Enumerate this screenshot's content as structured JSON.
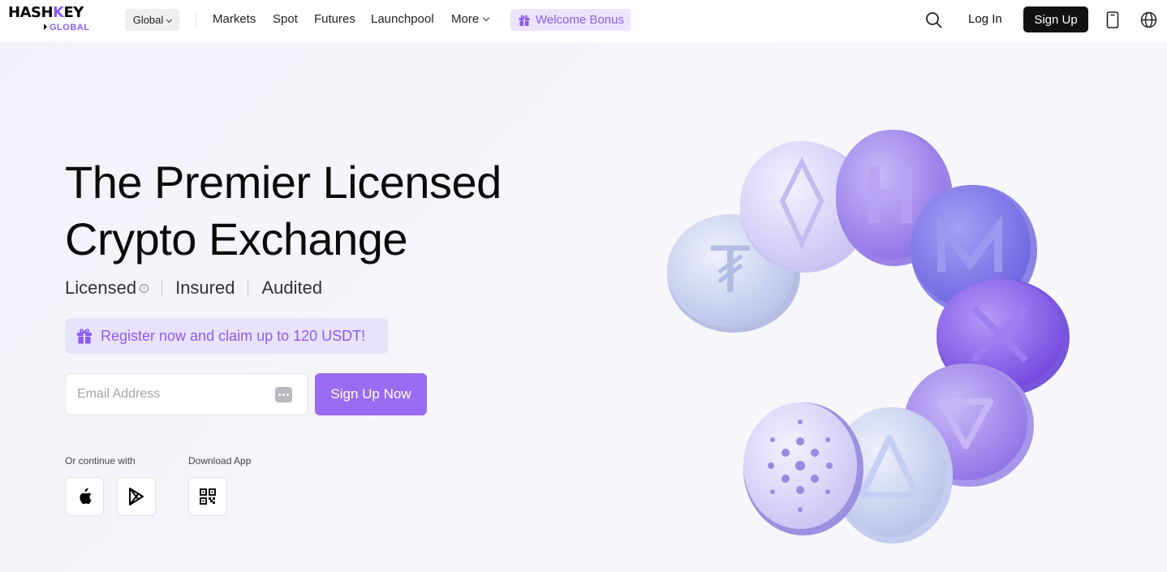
{
  "brand": {
    "name_part1": "HASH",
    "name_k": "K",
    "name_part2": "EY",
    "sub": "GLOBAL"
  },
  "header": {
    "region": "Global",
    "nav": [
      "Markets",
      "Spot",
      "Futures",
      "Launchpool",
      "More"
    ],
    "bonus_label": "Welcome Bonus",
    "login_label": "Log In",
    "signup_label": "Sign Up"
  },
  "hero": {
    "title_line1": "The Premier Licensed",
    "title_line2": "Crypto Exchange",
    "badges": [
      "Licensed",
      "Insured",
      "Audited"
    ],
    "info_mark": "i",
    "promo_text": "Register now and claim up to 120 USDT!",
    "email_placeholder": "Email Address",
    "signup_now_label": "Sign Up Now",
    "continue_with_label": "Or continue with",
    "download_app_label": "Download App"
  },
  "icons": {
    "apple": "apple-icon",
    "google_play": "google-play-icon",
    "qr": "qr-code-icon",
    "search": "search-icon",
    "phone": "phone-icon",
    "globe": "globe-icon",
    "gift": "gift-icon"
  },
  "colors": {
    "accent": "#8b5cf6",
    "button": "#9a6cf3",
    "dark": "#111111"
  }
}
